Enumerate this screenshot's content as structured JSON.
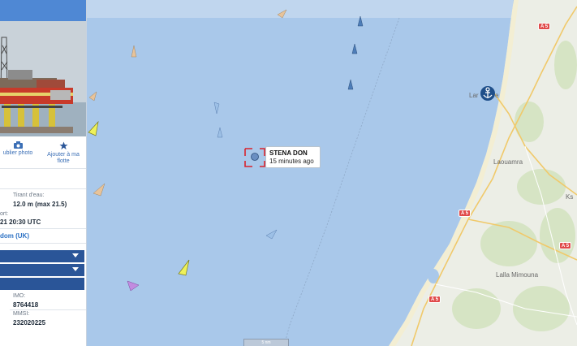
{
  "colors": {
    "sea": "#a9c8ea",
    "land": "#eceee6",
    "panel_header": "#4f88d4",
    "panel_bar": "#2a5598",
    "selected_marker": "#d9232d"
  },
  "panel": {
    "actions": {
      "upload_photo": {
        "label": "ublier photo",
        "icon": "camera-icon"
      },
      "add_to_fleet": {
        "label": "Ajouter à ma flotte",
        "icon": "star-icon"
      }
    },
    "draught": {
      "label": "Tirant d'eau:",
      "value": "12.0 m (max 21.5)"
    },
    "port_label": "ort:",
    "timestamp": "21 20:30 UTC",
    "flag": "dom (UK)",
    "imo": {
      "label": "IMO:",
      "value": "8764418"
    },
    "mmsi": {
      "label": "MMSI:",
      "value": "232020225"
    }
  },
  "map": {
    "selected_vessel": {
      "name": "STENA DON",
      "last_seen": "15 minutes ago"
    },
    "towns": {
      "port": "Lar",
      "port_suffix": "e",
      "laouamra": "Laouamra",
      "lalla_mimouna": "Lalla Mimouna",
      "ksar": "Ks"
    },
    "road_shields": [
      "A 5",
      "A 5",
      "A 5",
      "A 5"
    ],
    "scale_label": "5 nm",
    "port_icon": "anchor-icon"
  }
}
